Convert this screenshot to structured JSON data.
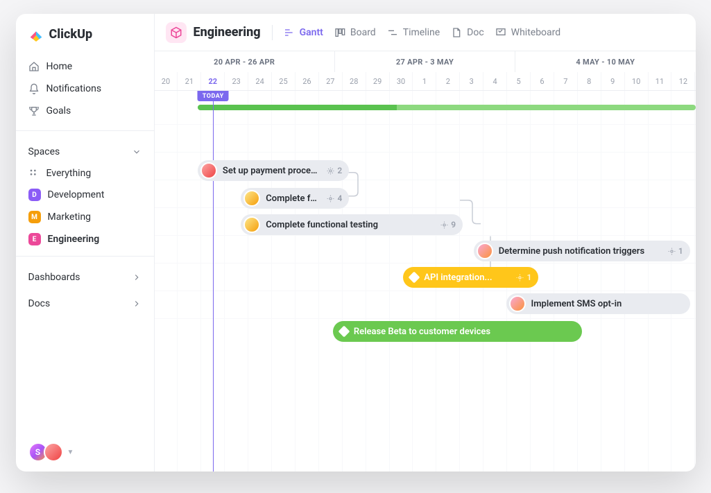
{
  "logo": "ClickUp",
  "nav": [
    {
      "icon": "home",
      "label": "Home"
    },
    {
      "icon": "bell",
      "label": "Notifications"
    },
    {
      "icon": "goals",
      "label": "Goals"
    }
  ],
  "spaces_header": "Spaces",
  "everything_label": "Everything",
  "spaces": [
    {
      "letter": "D",
      "color": "#8b5cf6",
      "label": "Development"
    },
    {
      "letter": "M",
      "color": "#f59e0b",
      "label": "Marketing"
    },
    {
      "letter": "E",
      "color": "#ec4899",
      "label": "Engineering",
      "active": true
    }
  ],
  "sections": [
    {
      "label": "Dashboards"
    },
    {
      "label": "Docs"
    }
  ],
  "user_badge_letter": "S",
  "breadcrumb_title": "Engineering",
  "views": [
    {
      "icon": "gantt",
      "label": "Gantt",
      "active": true
    },
    {
      "icon": "board",
      "label": "Board"
    },
    {
      "icon": "timeline",
      "label": "Timeline"
    },
    {
      "icon": "doc",
      "label": "Doc"
    },
    {
      "icon": "whiteboard",
      "label": "Whiteboard"
    }
  ],
  "ranges": [
    "20 APR - 26 APR",
    "27 APR - 3 MAY",
    "4 MAY - 10 MAY"
  ],
  "days": [
    "20",
    "21",
    "22",
    "23",
    "24",
    "25",
    "26",
    "27",
    "28",
    "29",
    "30",
    "1",
    "2",
    "3",
    "4",
    "5",
    "6",
    "7",
    "8",
    "9",
    "10",
    "11",
    "12"
  ],
  "today_index": 2,
  "today_label": "TODAY",
  "tasks": {
    "t1": {
      "label": "Set up payment processing",
      "count": "2"
    },
    "t2": {
      "label": "Complete functio...",
      "count": "4"
    },
    "t3": {
      "label": "Complete functional testing",
      "count": "9"
    },
    "t4": {
      "label": "Determine push notification triggers",
      "count": "1"
    },
    "t5": {
      "label": "API integration...",
      "count": "1"
    },
    "t6": {
      "label": "Implement SMS opt-in"
    },
    "t7": {
      "label": "Release Beta to customer devices"
    }
  }
}
